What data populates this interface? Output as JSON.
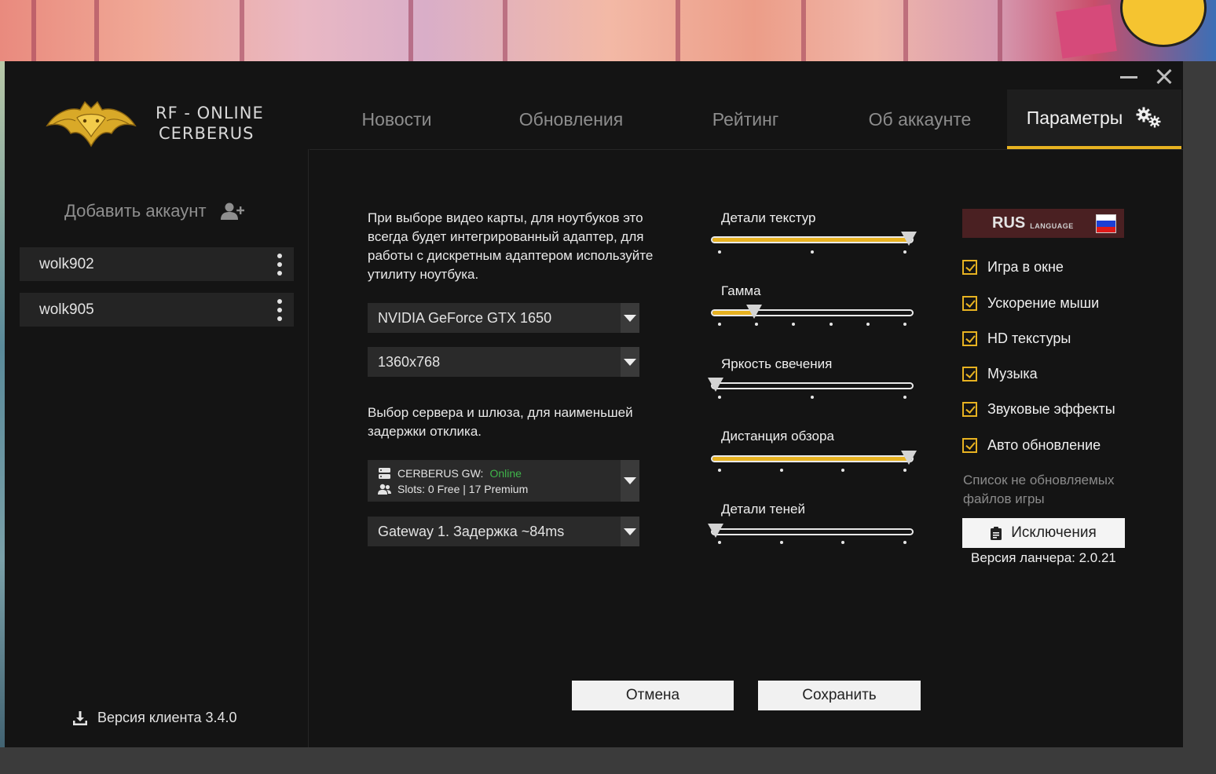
{
  "app": {
    "name_line1": "RF - ONLINE",
    "name_line2": "CERBERUS"
  },
  "nav": {
    "tabs": [
      {
        "label": "Новости"
      },
      {
        "label": "Обновления"
      },
      {
        "label": "Рейтинг"
      },
      {
        "label": "Об аккаунте"
      },
      {
        "label": "Параметры",
        "active": true
      }
    ]
  },
  "sidebar": {
    "add_account_label": "Добавить аккаунт",
    "accounts": [
      {
        "name": "wolk902"
      },
      {
        "name": "wolk905"
      }
    ],
    "client_version": "Версия клиента 3.4.0"
  },
  "settings": {
    "gpu_note": "При выборе видео карты, для ноутбуков это всегда будет интегрированный адаптер, для работы с дискретным адаптером используйте утилиту ноутбука.",
    "gpu_select": "NVIDIA GeForce GTX 1650",
    "resolution_select": "1360x768",
    "server_note": "Выбор сервера и шлюза, для наименьшей задержки отклика.",
    "server": {
      "name": "CERBERUS GW:",
      "status": "Online",
      "slots": "Slots: 0 Free | 17 Premium"
    },
    "gateway_select": "Gateway 1. Задержка ~84ms",
    "sliders": [
      {
        "label": "Детали текстур",
        "value": 1.0,
        "ticks": 3
      },
      {
        "label": "Гамма",
        "value": 0.2,
        "ticks": 6
      },
      {
        "label": "Яркость свечения",
        "value": 0.0,
        "ticks": 3
      },
      {
        "label": "Дистанция обзора",
        "value": 1.0,
        "ticks": 4
      },
      {
        "label": "Детали теней",
        "value": 0.0,
        "ticks": 4
      }
    ],
    "language": {
      "code": "RUS",
      "word": "LANGUAGE"
    },
    "checkboxes": [
      {
        "label": "Игра в окне",
        "checked": true
      },
      {
        "label": "Ускорение мыши",
        "checked": true
      },
      {
        "label": "HD текстуры",
        "checked": true
      },
      {
        "label": "Музыка",
        "checked": true
      },
      {
        "label": "Звуковые эффекты",
        "checked": true
      },
      {
        "label": "Авто обновление",
        "checked": true
      }
    ],
    "exclusions_note": "Список не обновляемых файлов игры",
    "exclusions_button": "Исключения",
    "launcher_version": "Версия ланчера: 2.0.21"
  },
  "buttons": {
    "cancel": "Отмена",
    "save": "Сохранить"
  },
  "colors": {
    "accent": "#e7b221",
    "background": "#141414",
    "online": "#3fb54a",
    "language_bg": "#4a2022"
  }
}
